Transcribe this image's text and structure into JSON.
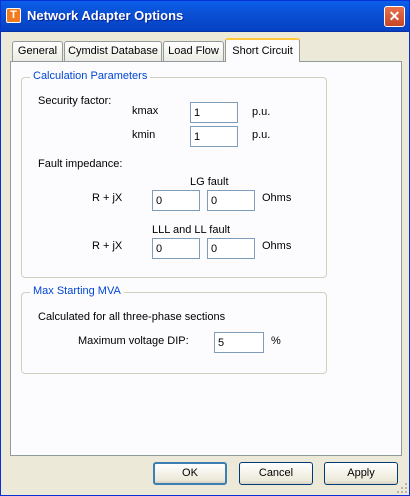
{
  "window": {
    "title": "Network Adapter Options",
    "app_icon_letter": "T",
    "close_glyph": "✕"
  },
  "tabs": [
    {
      "label": "General",
      "active": false
    },
    {
      "label": "Cymdist Database",
      "active": false
    },
    {
      "label": "Load Flow",
      "active": false
    },
    {
      "label": "Short Circuit",
      "active": true
    }
  ],
  "calc_params": {
    "title": "Calculation Parameters",
    "security_factor_label": "Security factor:",
    "kmax_label": "kmax",
    "kmax_value": "1",
    "kmin_label": "kmin",
    "kmin_value": "1",
    "unit_pu": "p.u.",
    "fault_impedance_label": "Fault impedance:",
    "lg_fault_label": "LG fault",
    "lg_r_label": "R + jX",
    "lg_r_value": "0",
    "lg_x_value": "0",
    "lll_fault_label": "LLL and LL fault",
    "lll_r_label": "R + jX",
    "lll_r_value": "0",
    "lll_x_value": "0",
    "unit_ohms": "Ohms"
  },
  "max_starting": {
    "title": "Max Starting MVA",
    "description": "Calculated for all three-phase sections",
    "voltage_dip_label": "Maximum voltage DIP:",
    "voltage_dip_value": "5",
    "unit_percent": "%"
  },
  "buttons": {
    "ok": "OK",
    "cancel": "Cancel",
    "apply": "Apply"
  },
  "colors": {
    "titlebar": "#0a4fd4",
    "group_title": "#0046d5",
    "dialog_bg": "#ece9d8",
    "active_tab_highlight": "#ffc83c"
  }
}
